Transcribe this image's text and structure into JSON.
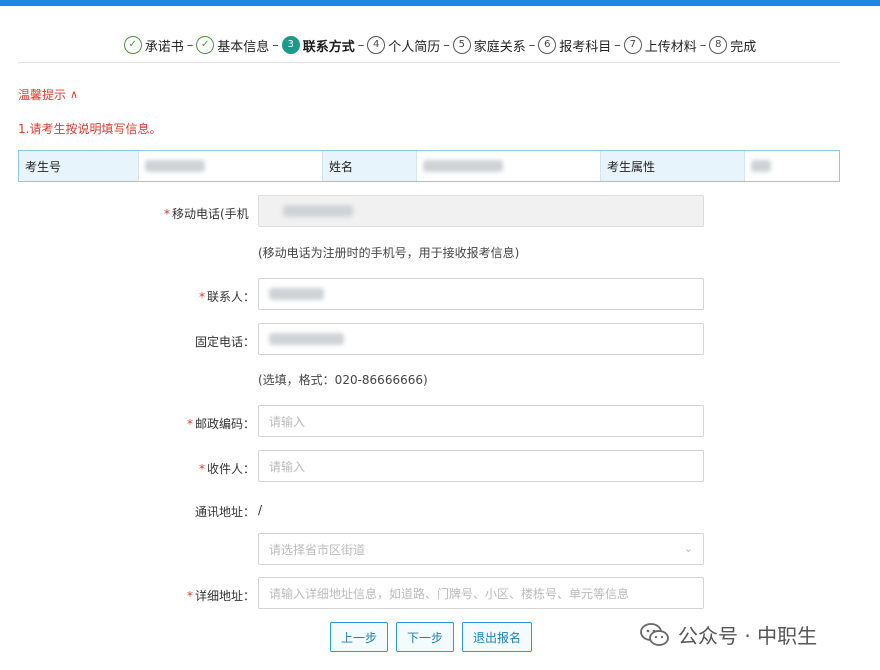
{
  "steps": [
    {
      "label": "承诺书",
      "marker": "✓",
      "state": "done"
    },
    {
      "label": "基本信息",
      "marker": "✓",
      "state": "done"
    },
    {
      "label": "联系方式",
      "marker": "3",
      "state": "active"
    },
    {
      "label": "个人简历",
      "marker": "4",
      "state": "todo"
    },
    {
      "label": "家庭关系",
      "marker": "5",
      "state": "todo"
    },
    {
      "label": "报考科目",
      "marker": "6",
      "state": "todo"
    },
    {
      "label": "上传材料",
      "marker": "7",
      "state": "todo"
    },
    {
      "label": "完成",
      "marker": "8",
      "state": "todo"
    }
  ],
  "step_separator": "–",
  "tip": {
    "title": "温馨提示",
    "toggle": "∧",
    "text": "1.请考生按说明填写信息。"
  },
  "info": {
    "exam_no_label": "考生号",
    "name_label": "姓名",
    "attr_label": "考生属性"
  },
  "form": {
    "required_mark": "*",
    "mobile_label": "移动电话(手机",
    "mobile_hint": "(移动电话为注册时的手机号，用于接收报考信息)",
    "contact_label": "联系人：",
    "landline_label": "固定电话：",
    "landline_hint": "(选填，格式：020-86666666)",
    "postcode_label": "邮政编码：",
    "postcode_placeholder": "请输入",
    "recipient_label": "收件人：",
    "recipient_placeholder": "请输入",
    "address_label": "通讯地址：",
    "address_value": "/",
    "region_placeholder": "请选择省市区街道",
    "detail_label": "详细地址：",
    "detail_placeholder": "请输入详细地址信息，如道路、门牌号、小区、楼栋号、单元等信息"
  },
  "buttons": {
    "prev": "上一步",
    "next": "下一步",
    "exit": "退出报名"
  },
  "watermark": {
    "text": "公众号 · 中职生"
  },
  "colors": {
    "accent": "#1e88e5",
    "required": "#e03a2e",
    "active_step": "#1a9a8a",
    "button_border": "#2a9ad0"
  }
}
